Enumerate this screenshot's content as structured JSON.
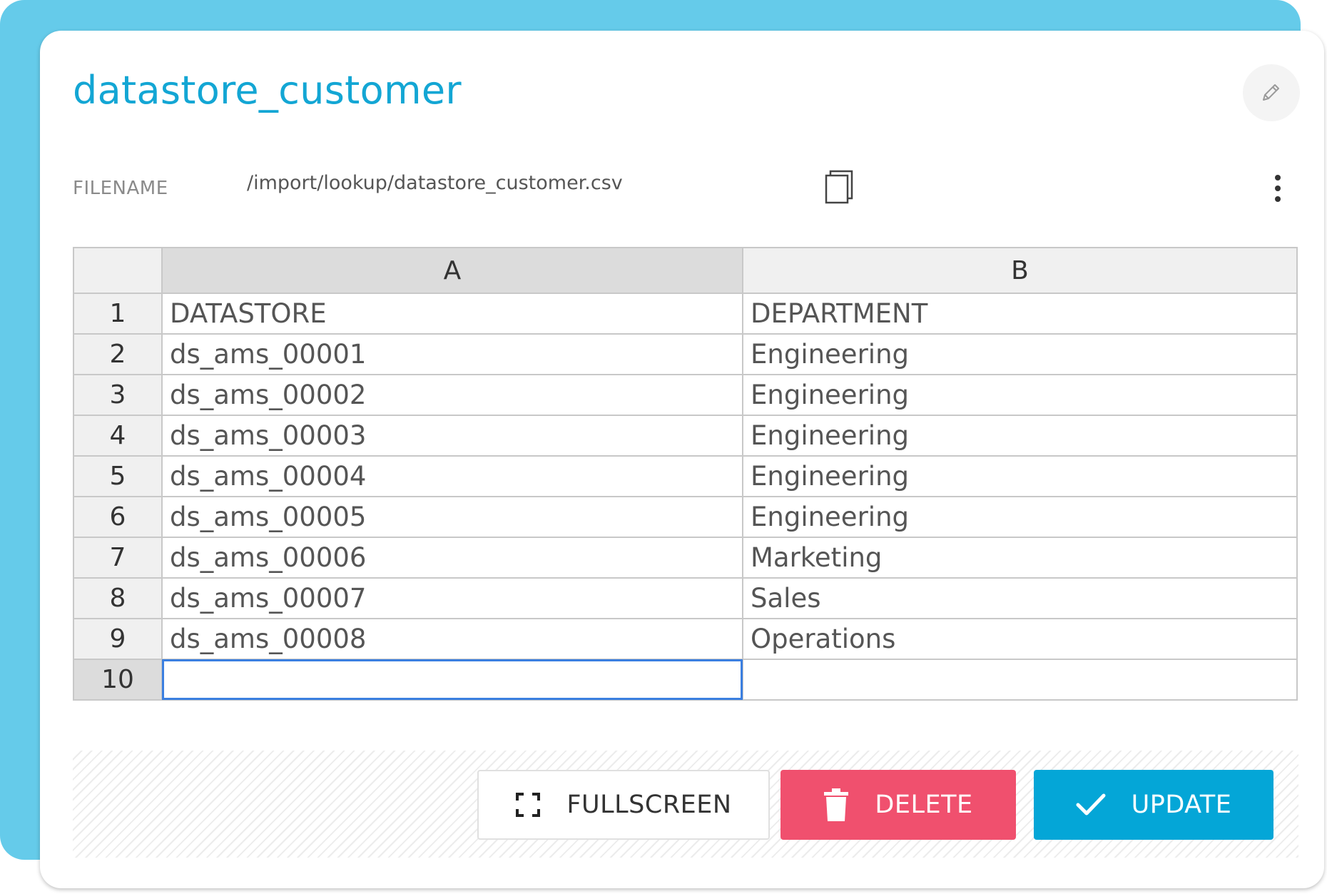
{
  "title": "datastore_customer",
  "filename": {
    "label": "FILENAME",
    "value": "/import/lookup/datastore_customer.csv"
  },
  "icons": {
    "edit": "pencil-icon",
    "copy": "copy-icon",
    "more": "more-vertical-icon",
    "fullscreen": "fullscreen-icon",
    "delete": "trash-icon",
    "update": "check-icon"
  },
  "sheet": {
    "columns": [
      "A",
      "B"
    ],
    "rows": [
      {
        "num": "1",
        "a": "DATASTORE",
        "b": "DEPARTMENT"
      },
      {
        "num": "2",
        "a": "ds_ams_00001",
        "b": "Engineering"
      },
      {
        "num": "3",
        "a": "ds_ams_00002",
        "b": "Engineering"
      },
      {
        "num": "4",
        "a": "ds_ams_00003",
        "b": "Engineering"
      },
      {
        "num": "5",
        "a": "ds_ams_00004",
        "b": "Engineering"
      },
      {
        "num": "6",
        "a": "ds_ams_00005",
        "b": "Engineering"
      },
      {
        "num": "7",
        "a": "ds_ams_00006",
        "b": "Marketing"
      },
      {
        "num": "8",
        "a": "ds_ams_00007",
        "b": "Sales"
      },
      {
        "num": "9",
        "a": "ds_ams_00008",
        "b": "Operations"
      },
      {
        "num": "10",
        "a": "",
        "b": ""
      }
    ]
  },
  "buttons": {
    "fullscreen": "FULLSCREEN",
    "delete": "DELETE",
    "update": "UPDATE"
  },
  "colors": {
    "accent": "#13a6d4",
    "backdrop": "#65cbea",
    "delete": "#f0506e",
    "update": "#04a6d7",
    "selection": "#3b7fe0"
  }
}
